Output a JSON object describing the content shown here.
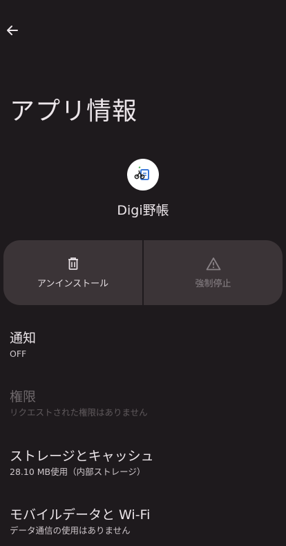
{
  "header": {
    "back_icon": "arrow-left-icon",
    "title": "アプリ情報"
  },
  "app": {
    "name": "Digi野帳",
    "icon": "app-logo-icon"
  },
  "actions": {
    "uninstall": {
      "label": "アンインストール",
      "icon": "trash-icon"
    },
    "force_stop": {
      "label": "強制停止",
      "icon": "warning-triangle-icon",
      "enabled": false
    }
  },
  "settings": [
    {
      "title": "通知",
      "subtitle": "OFF",
      "enabled": true
    },
    {
      "title": "権限",
      "subtitle": "リクエストされた権限はありません",
      "enabled": false
    },
    {
      "title": "ストレージとキャッシュ",
      "subtitle": "28.10 MB使用（内部ストレージ）",
      "enabled": true
    },
    {
      "title": "モバイルデータと Wi-Fi",
      "subtitle": "データ通信の使用はありません",
      "enabled": true
    }
  ]
}
